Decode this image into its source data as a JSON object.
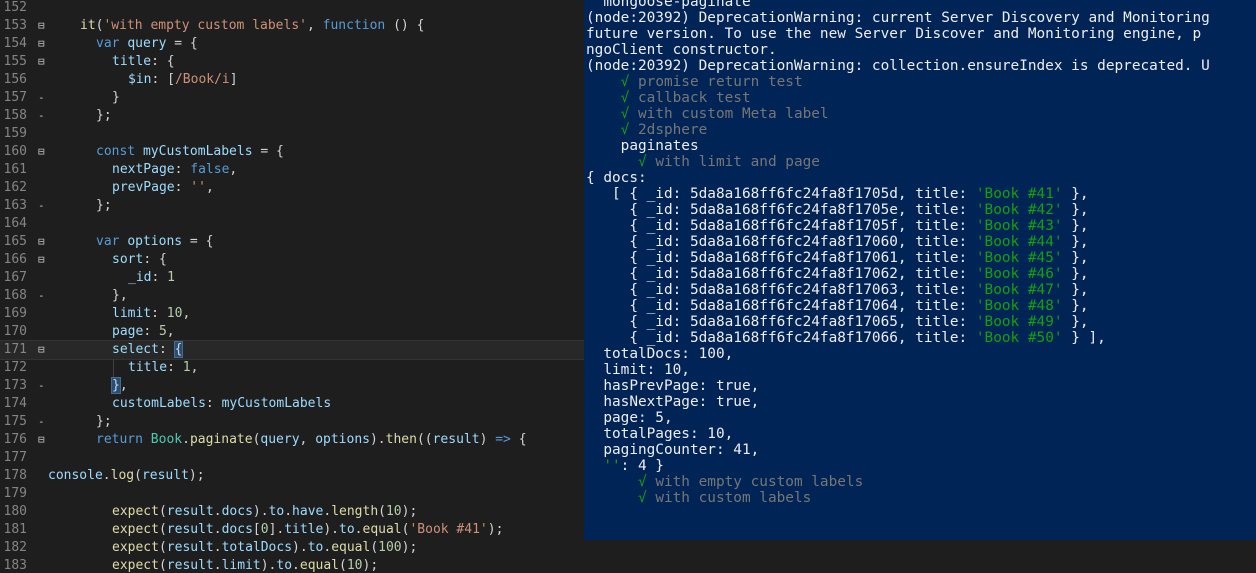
{
  "editor": {
    "lines": [
      {
        "n": "152",
        "fold": "",
        "active": false,
        "indent": 0,
        "seg": []
      },
      {
        "n": "153",
        "fold": "⊟",
        "active": false,
        "indent": 2,
        "seg": [
          [
            "f",
            "it"
          ],
          [
            "p",
            "("
          ],
          [
            "s",
            "'with empty custom labels'"
          ],
          [
            "p",
            ", "
          ],
          [
            "k",
            "function"
          ],
          [
            "p",
            " () {"
          ]
        ]
      },
      {
        "n": "154",
        "fold": "⊟",
        "active": false,
        "indent": 3,
        "seg": [
          [
            "k",
            "var"
          ],
          [
            "p",
            " "
          ],
          [
            "v",
            "query"
          ],
          [
            "p",
            " = {"
          ]
        ]
      },
      {
        "n": "155",
        "fold": "⊟",
        "active": false,
        "indent": 4,
        "seg": [
          [
            "v",
            "title"
          ],
          [
            "p",
            ": {"
          ]
        ]
      },
      {
        "n": "156",
        "fold": "",
        "active": false,
        "indent": 5,
        "seg": [
          [
            "v",
            "$in"
          ],
          [
            "p",
            ": ["
          ],
          [
            "s",
            "/Book/i"
          ],
          [
            "p",
            "]"
          ]
        ]
      },
      {
        "n": "157",
        "fold": "-",
        "active": false,
        "indent": 4,
        "seg": [
          [
            "p",
            "}"
          ]
        ]
      },
      {
        "n": "158",
        "fold": "-",
        "active": false,
        "indent": 3,
        "seg": [
          [
            "p",
            "};"
          ]
        ]
      },
      {
        "n": "159",
        "fold": "",
        "active": false,
        "indent": 0,
        "seg": []
      },
      {
        "n": "160",
        "fold": "⊟",
        "active": false,
        "indent": 3,
        "seg": [
          [
            "k",
            "const"
          ],
          [
            "p",
            " "
          ],
          [
            "v",
            "myCustomLabels"
          ],
          [
            "p",
            " = {"
          ]
        ]
      },
      {
        "n": "161",
        "fold": "",
        "active": false,
        "indent": 4,
        "seg": [
          [
            "v",
            "nextPage"
          ],
          [
            "p",
            ": "
          ],
          [
            "k",
            "false"
          ],
          [
            "p",
            ","
          ]
        ]
      },
      {
        "n": "162",
        "fold": "",
        "active": false,
        "indent": 4,
        "seg": [
          [
            "v",
            "prevPage"
          ],
          [
            "p",
            ": "
          ],
          [
            "s",
            "''"
          ],
          [
            "p",
            ","
          ]
        ]
      },
      {
        "n": "163",
        "fold": "-",
        "active": false,
        "indent": 3,
        "seg": [
          [
            "p",
            "};"
          ]
        ]
      },
      {
        "n": "164",
        "fold": "",
        "active": false,
        "indent": 0,
        "seg": []
      },
      {
        "n": "165",
        "fold": "⊟",
        "active": false,
        "indent": 3,
        "seg": [
          [
            "k",
            "var"
          ],
          [
            "p",
            " "
          ],
          [
            "v",
            "options"
          ],
          [
            "p",
            " = {"
          ]
        ]
      },
      {
        "n": "166",
        "fold": "⊟",
        "active": false,
        "indent": 4,
        "seg": [
          [
            "v",
            "sort"
          ],
          [
            "p",
            ": {"
          ]
        ]
      },
      {
        "n": "167",
        "fold": "",
        "active": false,
        "indent": 5,
        "seg": [
          [
            "v",
            "_id"
          ],
          [
            "p",
            ": "
          ],
          [
            "n",
            "1"
          ]
        ]
      },
      {
        "n": "168",
        "fold": "-",
        "active": false,
        "indent": 4,
        "seg": [
          [
            "p",
            "},"
          ]
        ]
      },
      {
        "n": "169",
        "fold": "",
        "active": false,
        "indent": 4,
        "seg": [
          [
            "v",
            "limit"
          ],
          [
            "p",
            ": "
          ],
          [
            "n",
            "10"
          ],
          [
            "p",
            ","
          ]
        ]
      },
      {
        "n": "170",
        "fold": "",
        "active": false,
        "indent": 4,
        "seg": [
          [
            "v",
            "page"
          ],
          [
            "p",
            ": "
          ],
          [
            "n",
            "5"
          ],
          [
            "p",
            ","
          ]
        ]
      },
      {
        "n": "171",
        "fold": "⊟",
        "active": true,
        "indent": 4,
        "seg": [
          [
            "v",
            "select"
          ],
          [
            "p",
            ": "
          ],
          [
            "br",
            "{"
          ]
        ]
      },
      {
        "n": "172",
        "fold": "",
        "active": false,
        "indent": 5,
        "seg": [
          [
            "v",
            "title"
          ],
          [
            "p",
            ": "
          ],
          [
            "n",
            "1"
          ],
          [
            "p",
            ","
          ]
        ]
      },
      {
        "n": "173",
        "fold": "-",
        "active": false,
        "indent": 4,
        "seg": [
          [
            "br",
            "}"
          ],
          [
            "p",
            ","
          ]
        ]
      },
      {
        "n": "174",
        "fold": "",
        "active": false,
        "indent": 4,
        "seg": [
          [
            "v",
            "customLabels"
          ],
          [
            "p",
            ": "
          ],
          [
            "v",
            "myCustomLabels"
          ]
        ]
      },
      {
        "n": "175",
        "fold": "-",
        "active": false,
        "indent": 3,
        "seg": [
          [
            "p",
            "};"
          ]
        ]
      },
      {
        "n": "176",
        "fold": "⊟",
        "active": false,
        "indent": 3,
        "seg": [
          [
            "k",
            "return"
          ],
          [
            "p",
            " "
          ],
          [
            "t",
            "Book"
          ],
          [
            "p",
            "."
          ],
          [
            "f",
            "paginate"
          ],
          [
            "p",
            "("
          ],
          [
            "v",
            "query"
          ],
          [
            "p",
            ", "
          ],
          [
            "v",
            "options"
          ],
          [
            "p",
            ")."
          ],
          [
            "f",
            "then"
          ],
          [
            "p",
            "(("
          ],
          [
            "v",
            "result"
          ],
          [
            "p",
            ") "
          ],
          [
            "k",
            "=>"
          ],
          [
            "p",
            " {"
          ]
        ]
      },
      {
        "n": "177",
        "fold": "",
        "active": false,
        "indent": 0,
        "seg": []
      },
      {
        "n": "178",
        "fold": "",
        "active": false,
        "indent": 0,
        "seg": [
          [
            "v",
            "console"
          ],
          [
            "p",
            "."
          ],
          [
            "f",
            "log"
          ],
          [
            "p",
            "("
          ],
          [
            "v",
            "result"
          ],
          [
            "p",
            ");"
          ]
        ]
      },
      {
        "n": "179",
        "fold": "",
        "active": false,
        "indent": 0,
        "seg": []
      },
      {
        "n": "180",
        "fold": "",
        "active": false,
        "indent": 4,
        "seg": [
          [
            "f",
            "expect"
          ],
          [
            "p",
            "("
          ],
          [
            "v",
            "result"
          ],
          [
            "p",
            "."
          ],
          [
            "v",
            "docs"
          ],
          [
            "p",
            ")."
          ],
          [
            "v",
            "to"
          ],
          [
            "p",
            "."
          ],
          [
            "v",
            "have"
          ],
          [
            "p",
            "."
          ],
          [
            "f",
            "length"
          ],
          [
            "p",
            "("
          ],
          [
            "n",
            "10"
          ],
          [
            "p",
            ");"
          ]
        ]
      },
      {
        "n": "181",
        "fold": "",
        "active": false,
        "indent": 4,
        "seg": [
          [
            "f",
            "expect"
          ],
          [
            "p",
            "("
          ],
          [
            "v",
            "result"
          ],
          [
            "p",
            "."
          ],
          [
            "v",
            "docs"
          ],
          [
            "p",
            "["
          ],
          [
            "n",
            "0"
          ],
          [
            "p",
            "]."
          ],
          [
            "v",
            "title"
          ],
          [
            "p",
            ")."
          ],
          [
            "v",
            "to"
          ],
          [
            "p",
            "."
          ],
          [
            "f",
            "equal"
          ],
          [
            "p",
            "("
          ],
          [
            "s",
            "'Book #41'"
          ],
          [
            "p",
            ");"
          ]
        ]
      },
      {
        "n": "182",
        "fold": "",
        "active": false,
        "indent": 4,
        "seg": [
          [
            "f",
            "expect"
          ],
          [
            "p",
            "("
          ],
          [
            "v",
            "result"
          ],
          [
            "p",
            "."
          ],
          [
            "v",
            "totalDocs"
          ],
          [
            "p",
            ")."
          ],
          [
            "v",
            "to"
          ],
          [
            "p",
            "."
          ],
          [
            "f",
            "equal"
          ],
          [
            "p",
            "("
          ],
          [
            "n",
            "100"
          ],
          [
            "p",
            ");"
          ]
        ]
      },
      {
        "n": "183",
        "fold": "",
        "active": false,
        "indent": 4,
        "seg": [
          [
            "f",
            "expect"
          ],
          [
            "p",
            "("
          ],
          [
            "v",
            "result"
          ],
          [
            "p",
            "."
          ],
          [
            "v",
            "limit"
          ],
          [
            "p",
            ")."
          ],
          [
            "v",
            "to"
          ],
          [
            "p",
            "."
          ],
          [
            "f",
            "equal"
          ],
          [
            "p",
            "("
          ],
          [
            "n",
            "10"
          ],
          [
            "p",
            ");"
          ]
        ]
      }
    ]
  },
  "terminal": {
    "lines": [
      [
        [
          "",
          "  mongoose-paginate"
        ]
      ],
      [
        [
          "",
          "(node:20392) DeprecationWarning: current Server Discovery and Monitoring"
        ]
      ],
      [
        [
          "",
          "future version. To use the new Server Discover and Monitoring engine, p"
        ]
      ],
      [
        [
          "",
          "ngoClient constructor."
        ]
      ],
      [
        [
          "",
          "(node:20392) DeprecationWarning: collection.ensureIndex is deprecated. U"
        ]
      ],
      [
        [
          "",
          "    "
        ],
        [
          "chk",
          "√"
        ],
        [
          "gray",
          " promise return test"
        ]
      ],
      [
        [
          "",
          "    "
        ],
        [
          "chk",
          "√"
        ],
        [
          "gray",
          " callback test"
        ]
      ],
      [
        [
          "",
          "    "
        ],
        [
          "chk",
          "√"
        ],
        [
          "gray",
          " with custom Meta label"
        ]
      ],
      [
        [
          "",
          "    "
        ],
        [
          "chk",
          "√"
        ],
        [
          "gray",
          " 2dsphere"
        ]
      ],
      [
        [
          "",
          "    paginates"
        ]
      ],
      [
        [
          "",
          "      "
        ],
        [
          "chk",
          "√"
        ],
        [
          "gray",
          " with limit and page"
        ]
      ],
      [
        [
          "",
          "{ docs:"
        ]
      ],
      [
        [
          "",
          "   [ { _id: 5da8a168ff6fc24fa8f1705d, title: "
        ],
        [
          "grn",
          "'Book #41'"
        ],
        [
          "",
          " },"
        ]
      ],
      [
        [
          "",
          "     { _id: 5da8a168ff6fc24fa8f1705e, title: "
        ],
        [
          "grn",
          "'Book #42'"
        ],
        [
          "",
          " },"
        ]
      ],
      [
        [
          "",
          "     { _id: 5da8a168ff6fc24fa8f1705f, title: "
        ],
        [
          "grn",
          "'Book #43'"
        ],
        [
          "",
          " },"
        ]
      ],
      [
        [
          "",
          "     { _id: 5da8a168ff6fc24fa8f17060, title: "
        ],
        [
          "grn",
          "'Book #44'"
        ],
        [
          "",
          " },"
        ]
      ],
      [
        [
          "",
          "     { _id: 5da8a168ff6fc24fa8f17061, title: "
        ],
        [
          "grn",
          "'Book #45'"
        ],
        [
          "",
          " },"
        ]
      ],
      [
        [
          "",
          "     { _id: 5da8a168ff6fc24fa8f17062, title: "
        ],
        [
          "grn",
          "'Book #46'"
        ],
        [
          "",
          " },"
        ]
      ],
      [
        [
          "",
          "     { _id: 5da8a168ff6fc24fa8f17063, title: "
        ],
        [
          "grn",
          "'Book #47'"
        ],
        [
          "",
          " },"
        ]
      ],
      [
        [
          "",
          "     { _id: 5da8a168ff6fc24fa8f17064, title: "
        ],
        [
          "grn",
          "'Book #48'"
        ],
        [
          "",
          " },"
        ]
      ],
      [
        [
          "",
          "     { _id: 5da8a168ff6fc24fa8f17065, title: "
        ],
        [
          "grn",
          "'Book #49'"
        ],
        [
          "",
          " },"
        ]
      ],
      [
        [
          "",
          "     { _id: 5da8a168ff6fc24fa8f17066, title: "
        ],
        [
          "grn",
          "'Book #50'"
        ],
        [
          "",
          " } ],"
        ]
      ],
      [
        [
          "",
          "  totalDocs: 100,"
        ]
      ],
      [
        [
          "",
          "  limit: 10,"
        ]
      ],
      [
        [
          "",
          "  hasPrevPage: true,"
        ]
      ],
      [
        [
          "",
          "  hasNextPage: true,"
        ]
      ],
      [
        [
          "",
          "  page: 5,"
        ]
      ],
      [
        [
          "",
          "  totalPages: 10,"
        ]
      ],
      [
        [
          "",
          "  pagingCounter: 41,"
        ]
      ],
      [
        [
          "",
          "  "
        ],
        [
          "grn",
          "''"
        ],
        [
          "",
          ": 4 }"
        ]
      ],
      [
        [
          "",
          "      "
        ],
        [
          "chk",
          "√"
        ],
        [
          "gray",
          " with empty custom labels"
        ]
      ],
      [
        [
          "",
          "      "
        ],
        [
          "chk",
          "√"
        ],
        [
          "gray",
          " with custom labels"
        ]
      ]
    ]
  }
}
